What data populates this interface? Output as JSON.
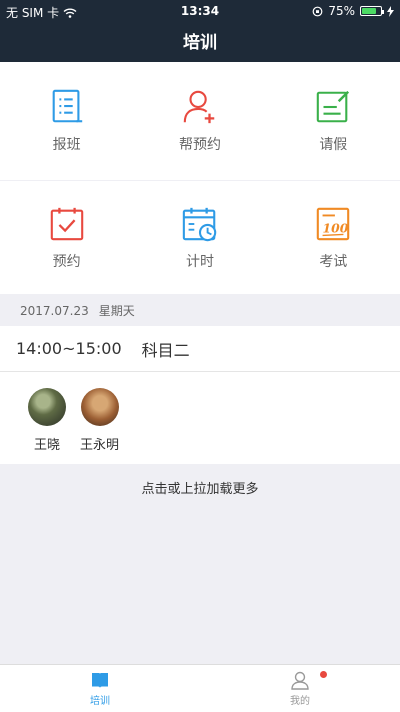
{
  "status_bar": {
    "carrier": "无 SIM 卡",
    "time": "13:34",
    "battery": "75%",
    "battery_level": 0.75
  },
  "header": {
    "title": "培训"
  },
  "grid": {
    "row1": [
      {
        "label": "报班",
        "icon": "class-list-icon",
        "color": "#2e9be6"
      },
      {
        "label": "帮预约",
        "icon": "add-user-icon",
        "color": "#e8493f"
      },
      {
        "label": "请假",
        "icon": "edit-note-icon",
        "color": "#3ab04a"
      }
    ],
    "row2": [
      {
        "label": "预约",
        "icon": "calendar-check-icon",
        "color": "#e8493f"
      },
      {
        "label": "计时",
        "icon": "calendar-clock-icon",
        "color": "#2e9be6"
      },
      {
        "label": "考试",
        "icon": "exam-score-icon",
        "color": "#f08a24"
      }
    ]
  },
  "schedule": {
    "date": "2017.07.23",
    "weekday": "星期天",
    "time_range": "14:00~15:00",
    "subject": "科目二",
    "trainees": [
      {
        "name": "王晓"
      },
      {
        "name": "王永明"
      }
    ]
  },
  "load_more": "点击或上拉加载更多",
  "tabbar": {
    "tabs": [
      {
        "label": "培训",
        "active": true
      },
      {
        "label": "我的",
        "active": false
      }
    ]
  },
  "colors": {
    "nav_bg": "#1e2a38",
    "accent": "#2e9be6",
    "badge": "#e8493f"
  }
}
